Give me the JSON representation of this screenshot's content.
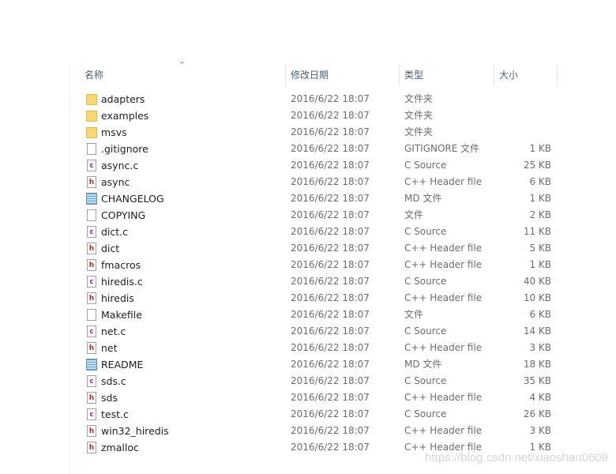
{
  "columns": {
    "name": "名称",
    "date": "修改日期",
    "type": "类型",
    "size": "大小"
  },
  "sort_indicator": "^",
  "files": [
    {
      "name": "adapters",
      "date": "2016/6/22 18:07",
      "type": "文件夹",
      "size": "",
      "icon": "folder"
    },
    {
      "name": "examples",
      "date": "2016/6/22 18:07",
      "type": "文件夹",
      "size": "",
      "icon": "folder"
    },
    {
      "name": "msvs",
      "date": "2016/6/22 18:07",
      "type": "文件夹",
      "size": "",
      "icon": "folder"
    },
    {
      "name": ".gitignore",
      "date": "2016/6/22 18:07",
      "type": "GITIGNORE 文件",
      "size": "1 KB",
      "icon": "file"
    },
    {
      "name": "async.c",
      "date": "2016/6/22 18:07",
      "type": "C Source",
      "size": "25 KB",
      "icon": "c"
    },
    {
      "name": "async",
      "date": "2016/6/22 18:07",
      "type": "C++ Header file",
      "size": "6 KB",
      "icon": "h"
    },
    {
      "name": "CHANGELOG",
      "date": "2016/6/22 18:07",
      "type": "MD 文件",
      "size": "1 KB",
      "icon": "txt"
    },
    {
      "name": "COPYING",
      "date": "2016/6/22 18:07",
      "type": "文件",
      "size": "2 KB",
      "icon": "file"
    },
    {
      "name": "dict.c",
      "date": "2016/6/22 18:07",
      "type": "C Source",
      "size": "11 KB",
      "icon": "c"
    },
    {
      "name": "dict",
      "date": "2016/6/22 18:07",
      "type": "C++ Header file",
      "size": "5 KB",
      "icon": "h"
    },
    {
      "name": "fmacros",
      "date": "2016/6/22 18:07",
      "type": "C++ Header file",
      "size": "1 KB",
      "icon": "h"
    },
    {
      "name": "hiredis.c",
      "date": "2016/6/22 18:07",
      "type": "C Source",
      "size": "40 KB",
      "icon": "c"
    },
    {
      "name": "hiredis",
      "date": "2016/6/22 18:07",
      "type": "C++ Header file",
      "size": "10 KB",
      "icon": "h"
    },
    {
      "name": "Makefile",
      "date": "2016/6/22 18:07",
      "type": "文件",
      "size": "6 KB",
      "icon": "file"
    },
    {
      "name": "net.c",
      "date": "2016/6/22 18:07",
      "type": "C Source",
      "size": "14 KB",
      "icon": "c"
    },
    {
      "name": "net",
      "date": "2016/6/22 18:07",
      "type": "C++ Header file",
      "size": "3 KB",
      "icon": "h"
    },
    {
      "name": "README",
      "date": "2016/6/22 18:07",
      "type": "MD 文件",
      "size": "18 KB",
      "icon": "txt"
    },
    {
      "name": "sds.c",
      "date": "2016/6/22 18:07",
      "type": "C Source",
      "size": "35 KB",
      "icon": "c"
    },
    {
      "name": "sds",
      "date": "2016/6/22 18:07",
      "type": "C++ Header file",
      "size": "4 KB",
      "icon": "h"
    },
    {
      "name": "test.c",
      "date": "2016/6/22 18:07",
      "type": "C Source",
      "size": "26 KB",
      "icon": "c"
    },
    {
      "name": "win32_hiredis",
      "date": "2016/6/22 18:07",
      "type": "C++ Header file",
      "size": "3 KB",
      "icon": "h"
    },
    {
      "name": "zmalloc",
      "date": "2016/6/22 18:07",
      "type": "C++ Header file",
      "size": "1 KB",
      "icon": "h"
    }
  ],
  "watermark": "https://blog.csdn.net/xiaoshan0609"
}
